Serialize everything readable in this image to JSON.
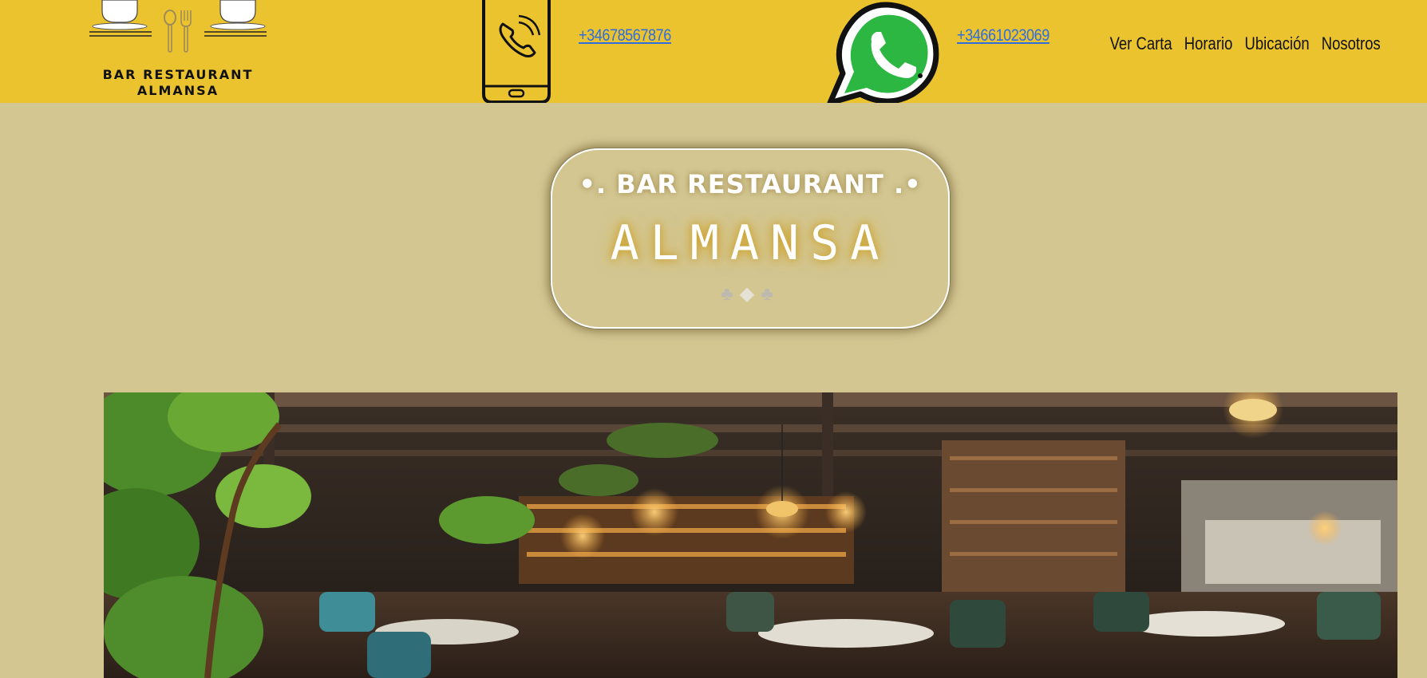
{
  "logo": {
    "line1": "BAR RESTAURANT",
    "line2": "ALMANSA",
    "icon_name": "coffee-cups-cutlery-logo"
  },
  "contacts": {
    "phone": {
      "icon_name": "phone-icon",
      "number": "+34678567876"
    },
    "whatsapp": {
      "icon_name": "whatsapp-icon",
      "number": "+34661023069"
    }
  },
  "nav": {
    "items": [
      {
        "label": "Ver Carta"
      },
      {
        "label": "Horario"
      },
      {
        "label": "Ubicación"
      },
      {
        "label": "Nosotros"
      }
    ]
  },
  "hero": {
    "subtitle": "•. BAR RESTAURANT .•",
    "title": "ALMANSA",
    "ornament_left": "♣",
    "ornament_center": "◆",
    "ornament_right": "♣"
  },
  "colors": {
    "header_bg": "#ebc32f",
    "page_bg": "#d3c691",
    "link": "#2d6de0",
    "whatsapp_green": "#2bb741"
  }
}
